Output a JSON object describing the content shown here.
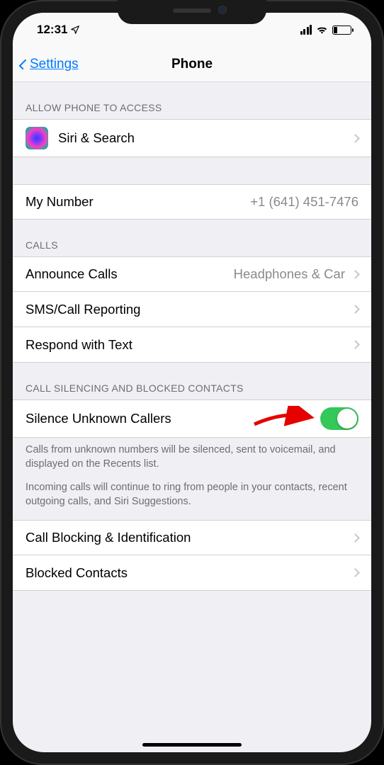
{
  "status": {
    "time": "12:31",
    "location_icon": "location-arrow"
  },
  "nav": {
    "back_label": "Settings",
    "title": "Phone"
  },
  "sections": {
    "access": {
      "header": "ALLOW PHONE TO ACCESS",
      "siri_label": "Siri & Search"
    },
    "number": {
      "label": "My Number",
      "value": "+1 (641) 451-7476"
    },
    "calls": {
      "header": "CALLS",
      "announce_label": "Announce Calls",
      "announce_value": "Headphones & Car",
      "sms_label": "SMS/Call Reporting",
      "respond_label": "Respond with Text"
    },
    "silencing": {
      "header": "CALL SILENCING AND BLOCKED CONTACTS",
      "silence_label": "Silence Unknown Callers",
      "footer1": "Calls from unknown numbers will be silenced, sent to voicemail, and displayed on the Recents list.",
      "footer2": "Incoming calls will continue to ring from people in your contacts, recent outgoing calls, and Siri Suggestions.",
      "blocking_label": "Call Blocking & Identification",
      "blocked_label": "Blocked Contacts"
    }
  }
}
